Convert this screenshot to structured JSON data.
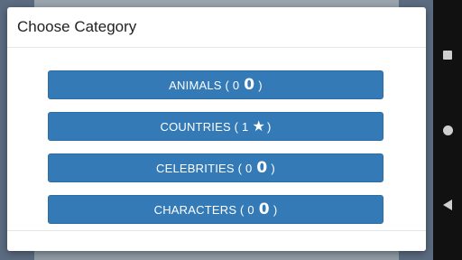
{
  "dialog": {
    "title": "Choose Category",
    "categories": [
      {
        "name": "ANIMALS",
        "count": "0",
        "badge": "0",
        "badge_type": "zero"
      },
      {
        "name": "COUNTRIES",
        "count": "1",
        "badge": "★",
        "badge_type": "star"
      },
      {
        "name": "CELEBRITIES",
        "count": "0",
        "badge": "0",
        "badge_type": "zero"
      },
      {
        "name": "CHARACTERS",
        "count": "0",
        "badge": "0",
        "badge_type": "zero"
      }
    ],
    "button_color": "#337ab7"
  },
  "system_nav": {
    "icons": [
      "recent-apps-icon",
      "home-icon",
      "back-icon"
    ]
  }
}
